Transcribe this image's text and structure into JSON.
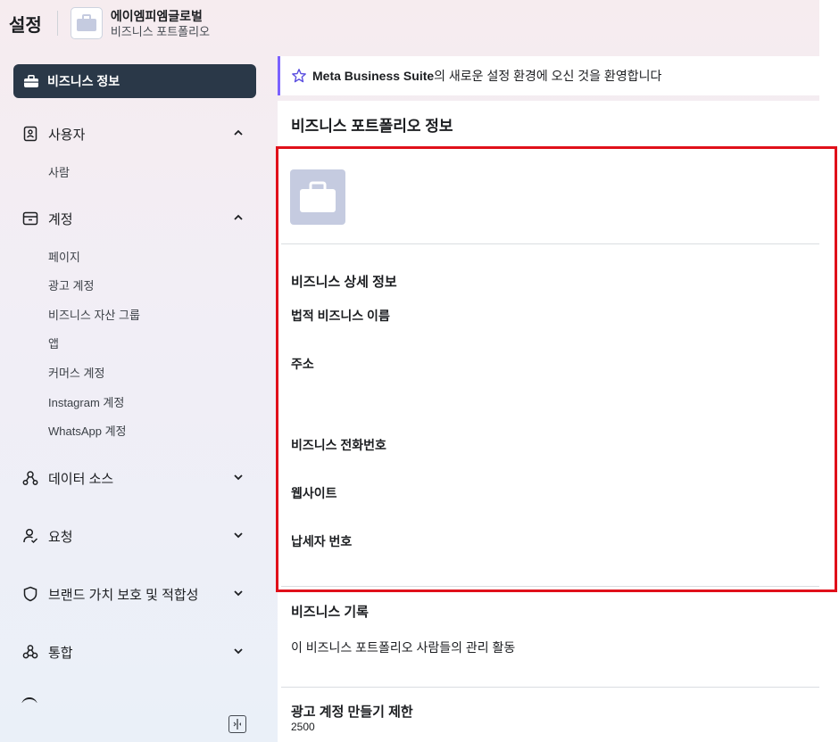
{
  "header": {
    "title": "설정",
    "portfolio_name": "에이엠피엠글로벌",
    "portfolio_sub": "비즈니스 포트폴리오"
  },
  "sidebar": {
    "active_item": "비즈니스 정보",
    "groups": [
      {
        "label": "사용자",
        "icon": "badge-icon",
        "expanded": true,
        "items": [
          "사람"
        ]
      },
      {
        "label": "계정",
        "icon": "archive-box-icon",
        "expanded": true,
        "items": [
          "페이지",
          "광고 계정",
          "비즈니스 자산 그룹",
          "앱",
          "커머스 계정",
          "Instagram 계정",
          "WhatsApp 계정"
        ]
      },
      {
        "label": "데이터 소스",
        "icon": "data-nodes-icon",
        "expanded": false
      },
      {
        "label": "요청",
        "icon": "person-check-icon",
        "expanded": false
      },
      {
        "label": "브랜드 가치 보호 및 적합성",
        "icon": "shield-icon",
        "expanded": false
      },
      {
        "label": "통합",
        "icon": "integration-icon",
        "expanded": false
      }
    ]
  },
  "banner": {
    "brand": "Meta Business Suite",
    "text": "의 새로운 설정 환경에 오신 것을 환영합니다"
  },
  "content": {
    "title": "비즈니스 포트폴리오 정보",
    "details_heading": "비즈니스 상세 정보",
    "fields": {
      "legal_name": "법적 비즈니스 이름",
      "address": "주소",
      "phone": "비즈니스 전화번호",
      "website": "웹사이트",
      "tax_id": "납세자 번호"
    },
    "history_heading": "비즈니스 기록",
    "history_text": "이 비즈니스 포트폴리오 사람들의 관리 활동",
    "limit_heading": "광고 계정 만들기 제한",
    "limit_value": "2500"
  },
  "colors": {
    "active_nav_bg": "#2a3848",
    "highlight_border": "#e0101a",
    "banner_accent": "#7b61ff"
  }
}
